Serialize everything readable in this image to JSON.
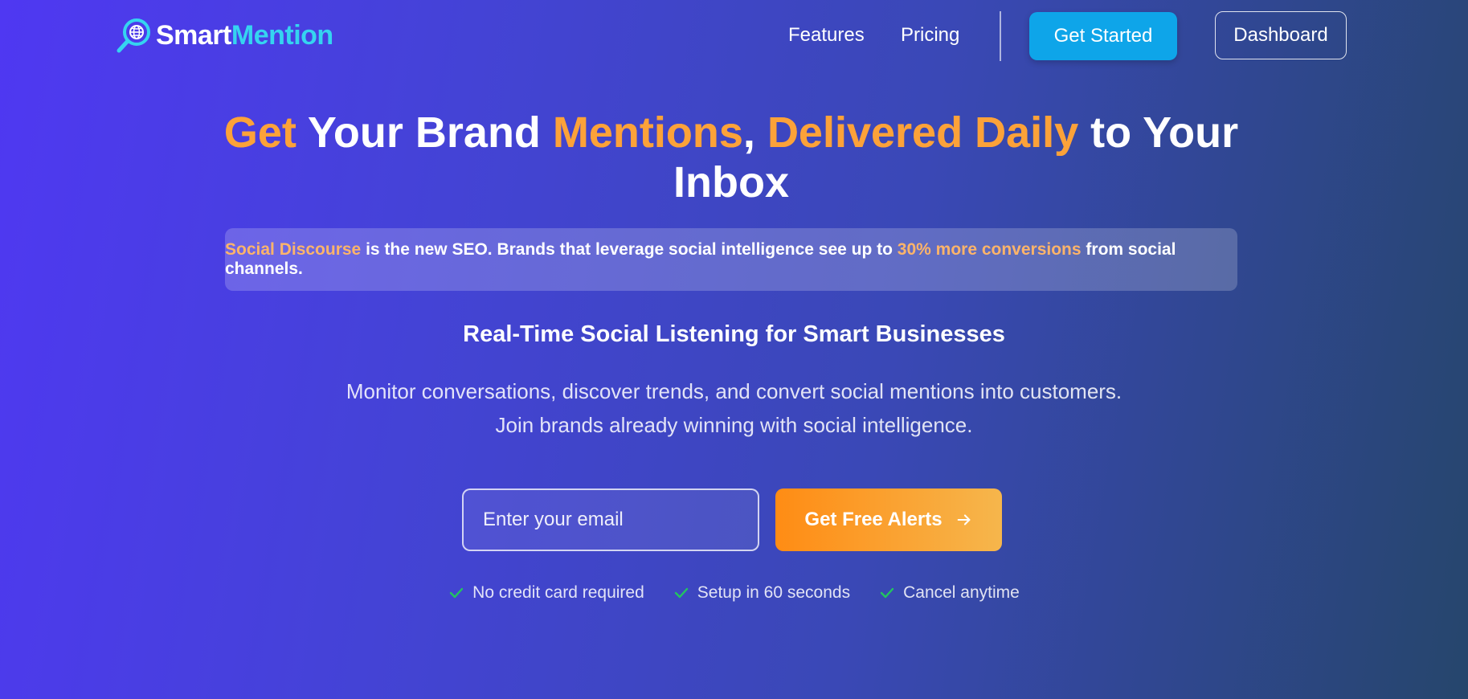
{
  "brand": {
    "name_part1": "Smart",
    "name_part2": "Mention",
    "icon": "magnifier-globe-icon"
  },
  "nav": {
    "features": "Features",
    "pricing": "Pricing",
    "get_started": "Get Started",
    "dashboard": "Dashboard"
  },
  "hero": {
    "headline": {
      "w1": "Get",
      "w2": " Your Brand ",
      "w3": "Mentions",
      "w4": ", ",
      "w5": "Delivered Daily",
      "w6": " to Your",
      "w7": "Inbox"
    },
    "banner": {
      "highlight1": "Social Discourse",
      "text1": " is the new SEO. Brands that leverage social intelligence see up to ",
      "highlight2": "30% more conversions",
      "text2": " from social channels."
    },
    "subheading": "Real-Time Social Listening for Smart Businesses",
    "description_line1": "Monitor conversations, discover trends, and convert social mentions into customers.",
    "description_line2": "Join brands already winning with social intelligence."
  },
  "signup": {
    "email_placeholder": "Enter your email",
    "email_value": "",
    "cta_label": "Get Free Alerts",
    "cta_icon": "arrow-right-icon"
  },
  "perks": [
    {
      "label": "No credit card required",
      "icon": "check-icon"
    },
    {
      "label": "Setup in 60 seconds",
      "icon": "check-icon"
    },
    {
      "label": "Cancel anytime",
      "icon": "check-icon"
    }
  ],
  "colors": {
    "accent_orange": "#fca239",
    "accent_cyan": "#35d4f0",
    "button_blue": "#0ea5e9",
    "check_green": "#22c55e"
  }
}
